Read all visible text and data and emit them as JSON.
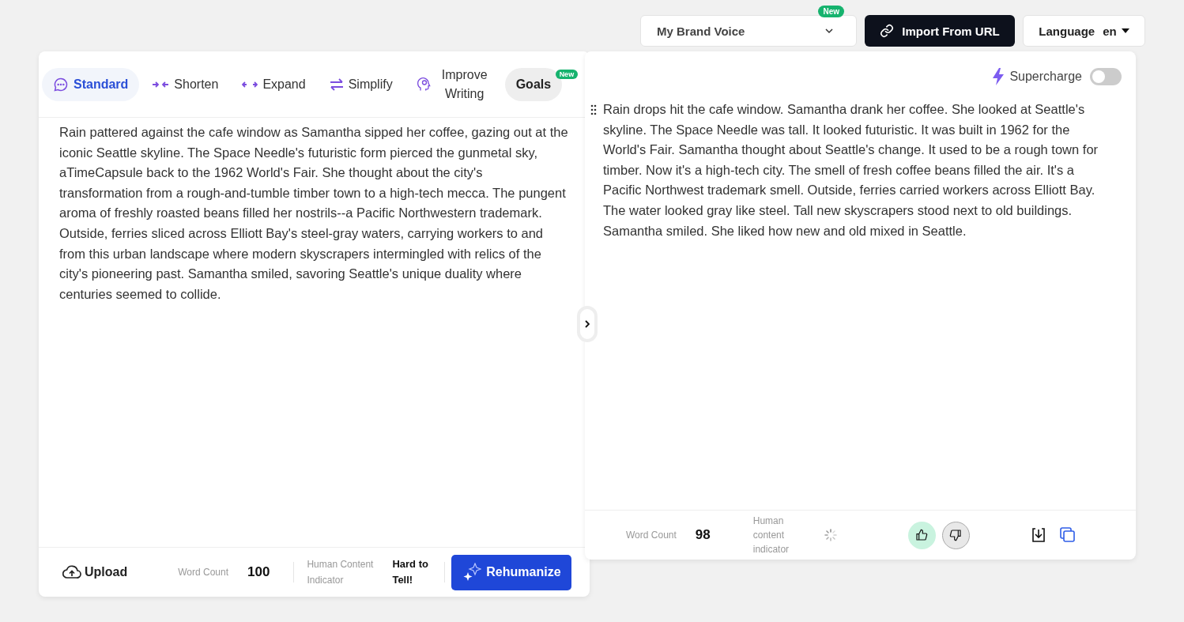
{
  "top_bar": {
    "brand_voice": {
      "label": "My Brand Voice",
      "badge": "New"
    },
    "import_button": "Import From URL",
    "language": {
      "label": "Language",
      "value": "en"
    }
  },
  "input_panel": {
    "tabs": [
      {
        "label": "Standard",
        "kind": "standard",
        "selected": true
      },
      {
        "label": "Shorten",
        "kind": "shorten",
        "selected": false
      },
      {
        "label": "Expand",
        "kind": "expand",
        "selected": false
      },
      {
        "label": "Simplify",
        "kind": "simplify",
        "selected": false
      },
      {
        "label": "Improve Writing",
        "kind": "improve",
        "selected": false
      },
      {
        "label": "Goals",
        "kind": "goals",
        "selected": false,
        "badge": "New"
      }
    ],
    "text": "Rain pattered against the cafe window as Samantha sipped her coffee, gazing out at the iconic Seattle skyline. The Space Needle's futuristic form pierced the gunmetal sky, aTimeCapsule back to the 1962 World's Fair. She thought about the city's transformation from a rough-and-tumble timber town to a high-tech mecca. The pungent aroma of freshly roasted beans filled her nostrils--a Pacific Northwestern trademark. Outside, ferries sliced across Elliott Bay's steel-gray waters, carrying workers to and from this urban landscape where modern skyscrapers intermingled with relics of the city's pioneering past. Samantha smiled, savoring Seattle's unique duality where centuries seemed to collide.",
    "footer": {
      "upload": "Upload",
      "word_count_label": "Word Count",
      "word_count": "100",
      "indicator_label": "Human Content Indicator",
      "indicator_value": "Hard to Tell!",
      "action": "Rehumanize"
    }
  },
  "output_panel": {
    "supercharge": {
      "label": "Supercharge",
      "on": false
    },
    "text": "Rain drops hit the cafe window. Samantha drank her coffee. She looked at Seattle's skyline. The Space Needle was tall. It looked futuristic. It was built in 1962 for the World's Fair. Samantha thought about Seattle's change. It used to be a rough town for timber. Now it's a high-tech city. The smell of fresh coffee beans filled the air. It's a Pacific Northwest trademark smell. Outside, ferries carried workers across Elliott Bay. The water looked gray like steel. Tall new skyscrapers stood next to old buildings. Samantha smiled. She liked how new and old mixed in Seattle.",
    "footer": {
      "word_count_label": "Word Count",
      "word_count": "98",
      "indicator_label": "Human content indicator",
      "thumbs_up": true,
      "thumbs_down": false
    }
  }
}
